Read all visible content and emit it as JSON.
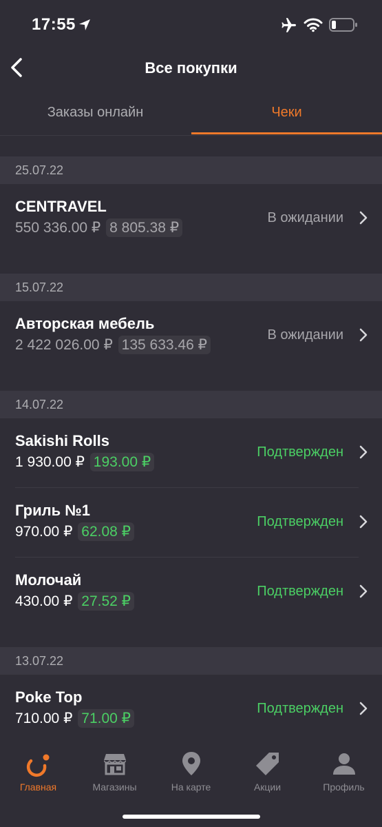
{
  "status_bar": {
    "time": "17:55"
  },
  "header": {
    "title": "Все покупки"
  },
  "tabs": [
    {
      "label": "Заказы онлайн",
      "active": false
    },
    {
      "label": "Чеки",
      "active": true
    }
  ],
  "groups": [
    {
      "date": "25.07.22",
      "items": [
        {
          "name": "CENTRAVEL",
          "amount": "550 336.00 ₽",
          "bonus": "8 805.38 ₽",
          "status": "В ожидании",
          "state": "pending"
        }
      ]
    },
    {
      "date": "15.07.22",
      "items": [
        {
          "name": "Авторская мебель",
          "amount": "2 422 026.00 ₽",
          "bonus": "135 633.46 ₽",
          "status": "В ожидании",
          "state": "pending"
        }
      ]
    },
    {
      "date": "14.07.22",
      "items": [
        {
          "name": "Sakishi Rolls",
          "amount": "1 930.00 ₽",
          "bonus": "193.00 ₽",
          "status": "Подтвержден",
          "state": "confirmed"
        },
        {
          "name": "Гриль №1",
          "amount": "970.00 ₽",
          "bonus": "62.08 ₽",
          "status": "Подтвержден",
          "state": "confirmed"
        },
        {
          "name": "Молочай",
          "amount": "430.00 ₽",
          "bonus": "27.52 ₽",
          "status": "Подтвержден",
          "state": "confirmed"
        }
      ]
    },
    {
      "date": "13.07.22",
      "items": [
        {
          "name": "Poke Top",
          "amount": "710.00 ₽",
          "bonus": "71.00 ₽",
          "status": "Подтвержден",
          "state": "confirmed"
        }
      ]
    }
  ],
  "tab_bar": [
    {
      "label": "Главная",
      "icon": "home-logo-icon",
      "active": true
    },
    {
      "label": "Магазины",
      "icon": "store-icon",
      "active": false
    },
    {
      "label": "На карте",
      "icon": "map-pin-icon",
      "active": false
    },
    {
      "label": "Акции",
      "icon": "tag-icon",
      "active": false
    },
    {
      "label": "Профиль",
      "icon": "profile-icon",
      "active": false
    }
  ],
  "colors": {
    "accent": "#f0792a",
    "confirmed": "#4bcf64",
    "pending": "#a7a6ab",
    "background": "#2f2d36"
  }
}
